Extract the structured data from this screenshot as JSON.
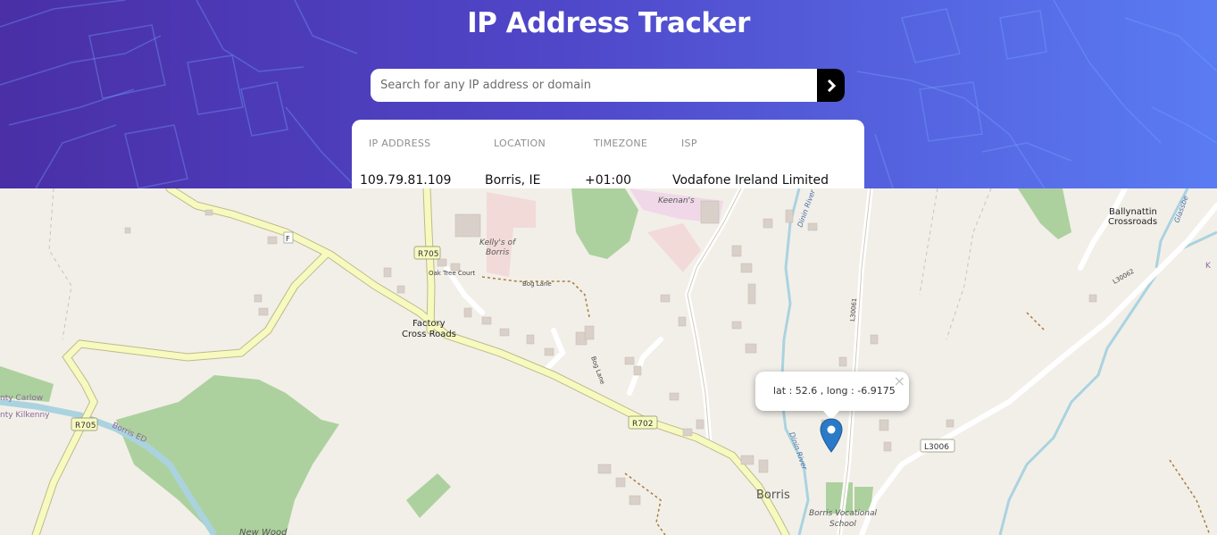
{
  "header": {
    "title": "IP Address Tracker",
    "search_placeholder": "Search for any IP address or domain",
    "search_value": "",
    "submit_icon": "chevron-right-icon"
  },
  "info": {
    "ip_label": "IP ADDRESS",
    "ip_value": "109.79.81.109",
    "location_label": "LOCATION",
    "location_value": "Borris, IE",
    "timezone_label": "TIMEZONE",
    "timezone_value": "+01:00",
    "isp_label": "ISP",
    "isp_value": "Vodafone Ireland Limited"
  },
  "map": {
    "popup_text": "lat : 52.6 , long : -6.9175",
    "popup_close": "×",
    "marker_icon": "map-pin-icon",
    "labels": {
      "r705_a": "R705",
      "r705_b": "R705",
      "r702": "R702",
      "l3006": "L3006",
      "l30061": "L30061",
      "l30062": "L30062",
      "kellys": "Kelly's of",
      "kellys2": "Borris",
      "keenans": "Keenan's",
      "oak_tree": "Oak Tree Court",
      "bog_lane": "Bog Lane",
      "bog_lane2": "Bog Lane",
      "factory1": "Factory",
      "factory2": "Cross Roads",
      "ballynattin1": "Ballynattin",
      "ballynattin2": "Crossroads",
      "borris": "Borris",
      "school1": "Borris Vocational",
      "school2": "School",
      "dinin1": "Dinin River",
      "dinin2": "Dinin River",
      "carlow": "nty Carlow",
      "kilkenny": "nty Kilkenny",
      "borris_ed": "Borris ED",
      "new_wood": "New Wood",
      "glassbe": "Glassbe",
      "f": "F",
      "k": "K"
    }
  },
  "colors": {
    "header_start": "#4a2fa6",
    "header_end": "#5a7cf3",
    "marker": "#2a7ac8",
    "river": "#aad3df",
    "road_yellow": "#f7fabf",
    "park": "#add19e",
    "land": "#f2efe9"
  }
}
